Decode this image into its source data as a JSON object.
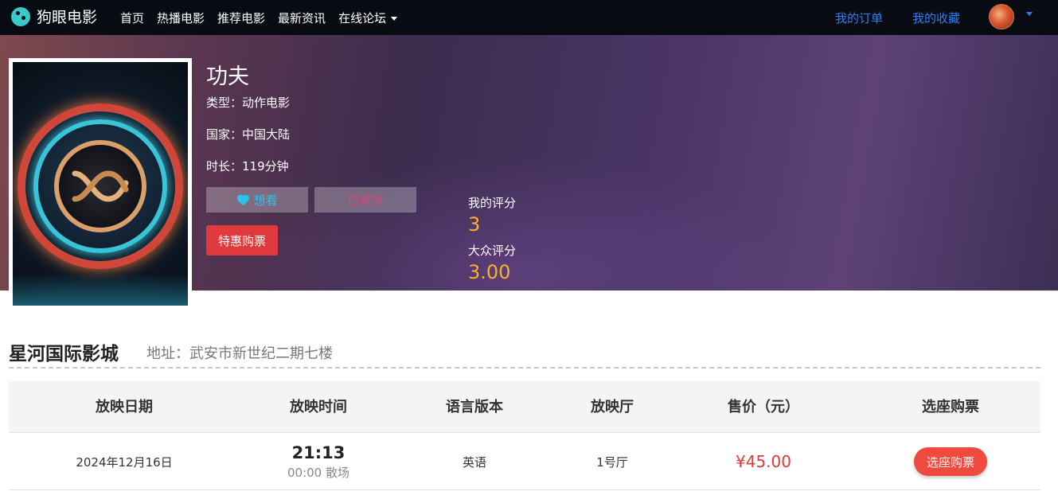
{
  "navbar": {
    "brand": "狗眼电影",
    "links": [
      "首页",
      "热播电影",
      "推荐电影",
      "最新资讯",
      "在线论坛"
    ],
    "my_orders": "我的订单",
    "my_favorites": "我的收藏"
  },
  "movie": {
    "title": "功夫",
    "genre": "类型：动作电影",
    "country": "国家：中国大陆",
    "duration": "时长：119分钟",
    "want_label": "想看",
    "rated_label": "已评分",
    "buy_label": "特惠购票",
    "my_score_label": "我的评分",
    "my_score": "3",
    "public_score_label": "大众评分",
    "public_score": "3.00"
  },
  "cinema": {
    "name": "星河国际影城",
    "address": "地址：武安市新世纪二期七楼"
  },
  "table": {
    "headers": [
      "放映日期",
      "放映时间",
      "语言版本",
      "放映厅",
      "售价（元）",
      "选座购票"
    ],
    "rows": [
      {
        "date": "2024年12月16日",
        "time": "21:13",
        "end": "00:00 散场",
        "language": "英语",
        "hall": "1号厅",
        "price": "¥45.00",
        "action": "选座购票"
      }
    ]
  },
  "colors": {
    "navbar_bg": "#080c12",
    "link_blue": "#2f7ef5",
    "score_gold": "#f6b12d",
    "buy_red": "#e0393e",
    "price_red": "#e03b36"
  },
  "icons": [
    "brand-logo-icon",
    "heart-icon",
    "dropdown-caret-icon",
    "avatar"
  ]
}
